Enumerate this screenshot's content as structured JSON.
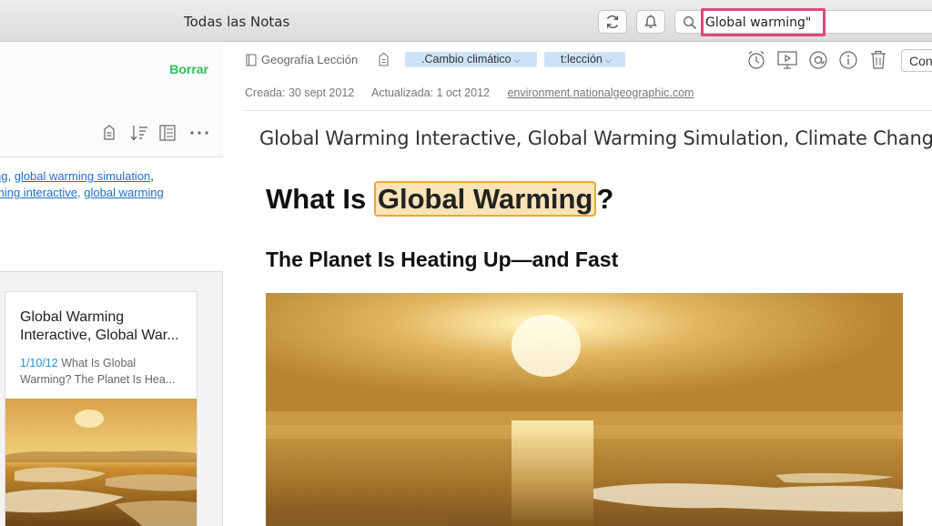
{
  "window": {
    "title": "Todas las Notas"
  },
  "toolbar": {
    "sync_icon": "sync-icon",
    "bell_icon": "bell-icon",
    "search_icon": "search-icon",
    "search_value": "Global warming\""
  },
  "sidebar": {
    "clear_label": "Borrar",
    "tag_lines": [
      {
        "prefix": "ng",
        "link1": "global warming simulation",
        "suffix": ","
      },
      {
        "prefix": "ming interactive",
        "link1": "global warming",
        "suffix": ""
      }
    ],
    "card": {
      "title": "Global Warming Interactive, Global War...",
      "date": "1/10/12",
      "snippet": "What Is Global Warming? The Planet Is Hea..."
    }
  },
  "note": {
    "notebook": "Geografía Lección",
    "tags": [
      ".Cambio climático",
      "t:lección"
    ],
    "present_label": "Con",
    "created": "Creada: 30 sept 2012",
    "updated": "Actualizada: 1 oct 2012",
    "source_url": "environment.nationalgeographic.com",
    "title": "Global Warming Interactive, Global Warming Simulation, Climate Change S",
    "heading_prefix": "What Is ",
    "heading_highlight": "Global Warming",
    "heading_suffix": "?",
    "subheading": "The Planet Is Heating Up—and Fast"
  },
  "colors": {
    "accent_green": "#2dbe60",
    "search_highlight": "#e0487a",
    "link_blue": "#1e6fcc",
    "tag_bg": "#cde3f8",
    "term_highlight": "#fbe3b8"
  }
}
